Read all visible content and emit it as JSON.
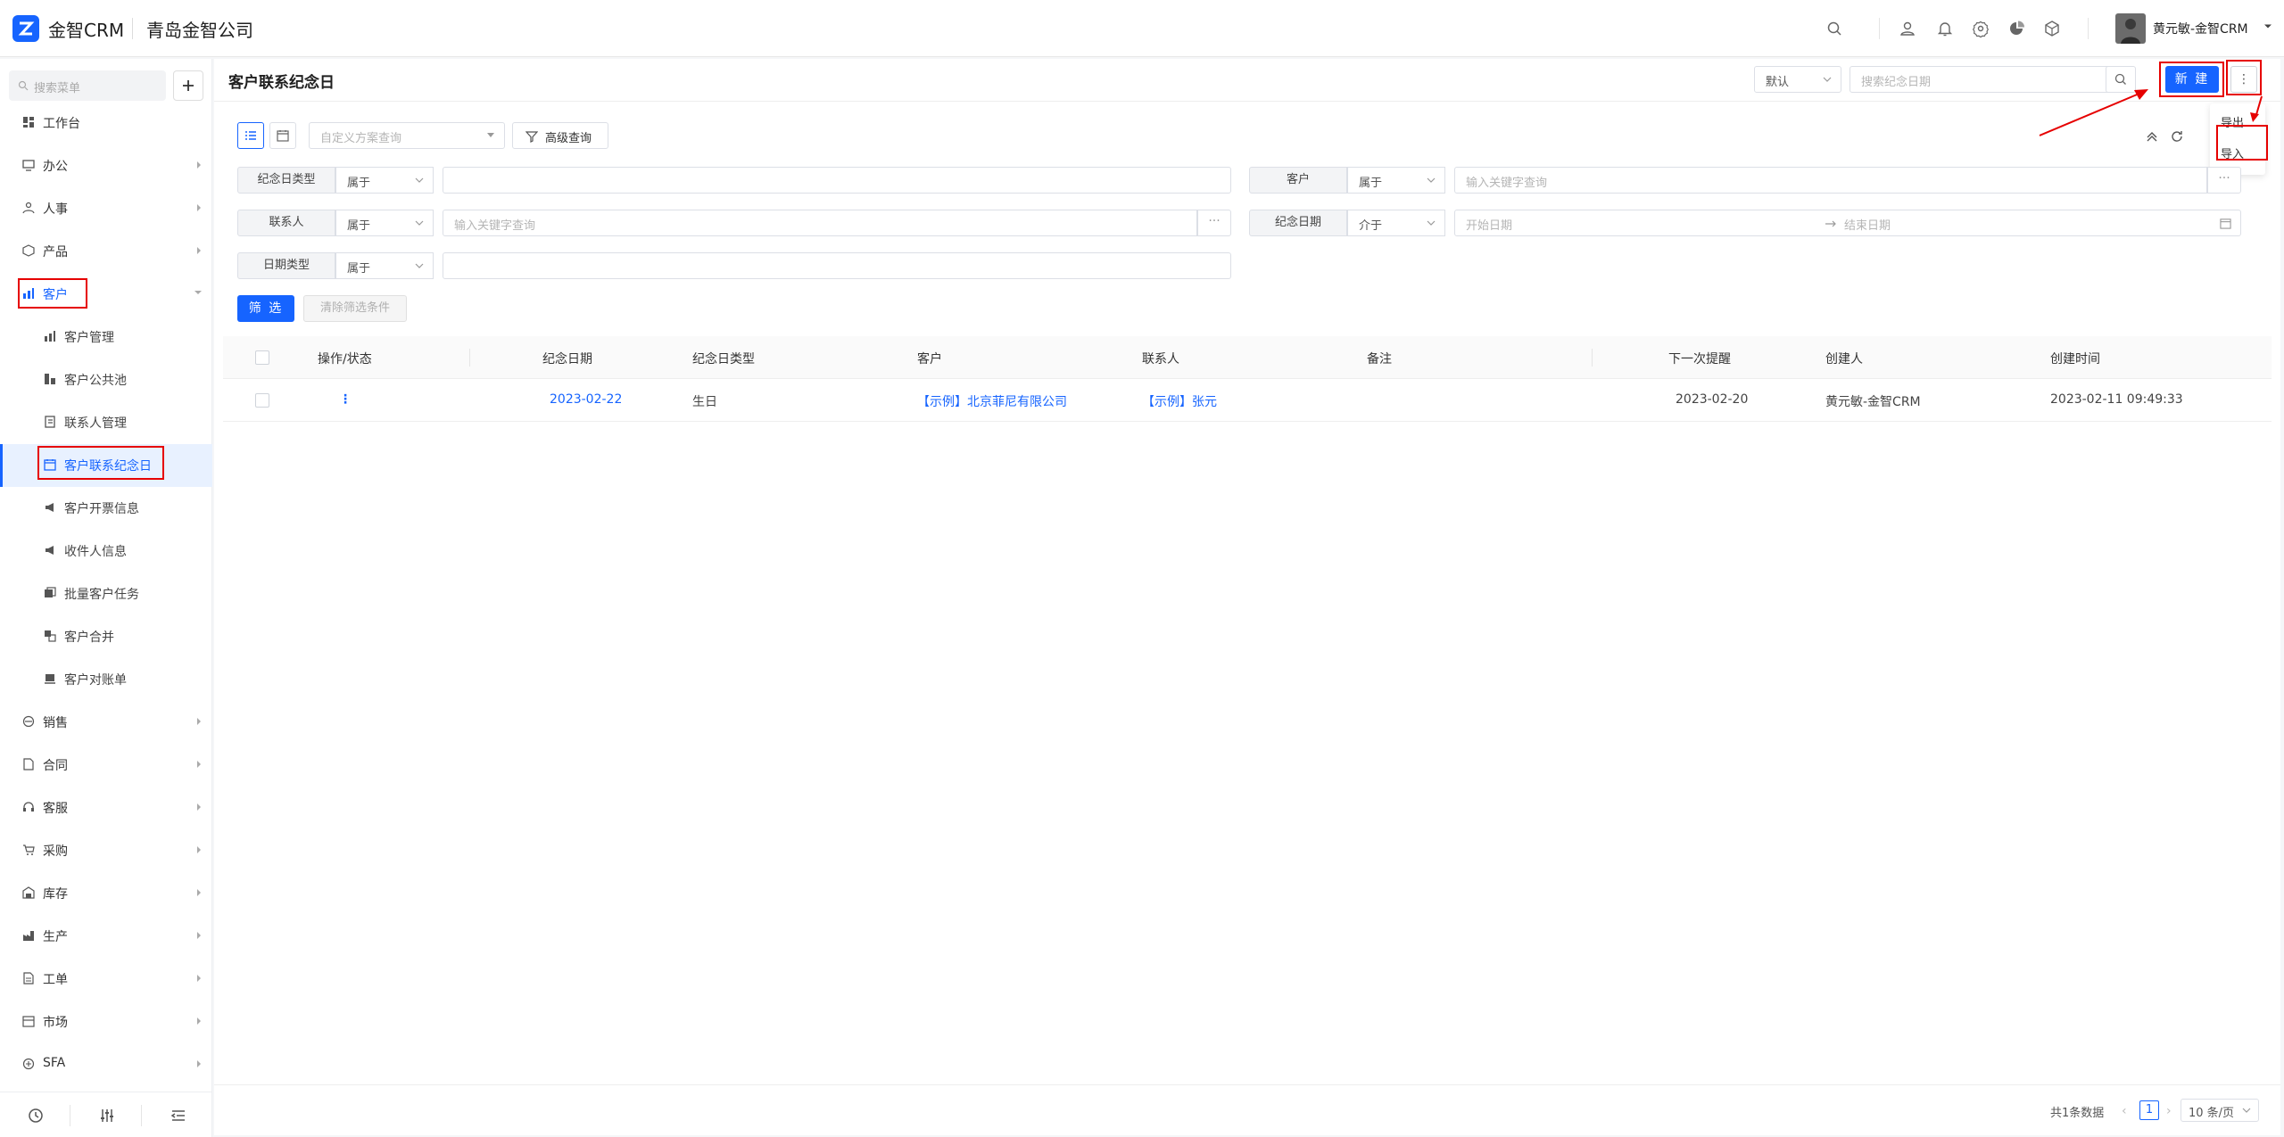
{
  "app": {
    "brand": "金智CRM",
    "company": "青岛金智公司",
    "user": "黄元敏-金智CRM"
  },
  "colors": {
    "accent": "#1664ff",
    "highlight_box": "#e60000"
  },
  "topbar_icons": [
    "search-icon",
    "contacts-icon",
    "bell-icon",
    "gear-icon",
    "pie-chart-icon",
    "cube-icon"
  ],
  "sidebar": {
    "search_placeholder": "搜索菜单",
    "items": [
      {
        "label": "工作台",
        "icon": "dashboard-icon"
      },
      {
        "label": "办公",
        "icon": "monitor-icon"
      },
      {
        "label": "人事",
        "icon": "people-icon"
      },
      {
        "label": "产品",
        "icon": "box-icon"
      },
      {
        "label": "客户",
        "icon": "chart-icon"
      },
      {
        "label": "销售",
        "icon": "target-icon"
      },
      {
        "label": "合同",
        "icon": "contract-icon"
      },
      {
        "label": "客服",
        "icon": "headset-icon"
      },
      {
        "label": "采购",
        "icon": "cart-icon"
      },
      {
        "label": "库存",
        "icon": "warehouse-icon"
      },
      {
        "label": "生产",
        "icon": "factory-icon"
      },
      {
        "label": "工单",
        "icon": "ticket-icon"
      },
      {
        "label": "市场",
        "icon": "store-icon"
      },
      {
        "label": "SFA",
        "icon": "sfa-icon"
      }
    ],
    "customer_sub": [
      {
        "label": "客户管理"
      },
      {
        "label": "客户公共池"
      },
      {
        "label": "联系人管理"
      },
      {
        "label": "客户联系纪念日"
      },
      {
        "label": "客户开票信息"
      },
      {
        "label": "收件人信息"
      },
      {
        "label": "批量客户任务"
      },
      {
        "label": "客户合并"
      },
      {
        "label": "客户对账单"
      }
    ]
  },
  "page": {
    "title": "客户联系纪念日",
    "view_select": "默认",
    "search_placeholder": "搜索纪念日期",
    "new_button": "新 建",
    "more_button": "⋮",
    "menu": {
      "export": "导出",
      "import": "导入"
    }
  },
  "filters": {
    "custom_query_placeholder": "自定义方案查询",
    "advanced": "高级查询",
    "rows": [
      {
        "label": "纪念日类型",
        "op": "属于",
        "placeholder": ""
      },
      {
        "label": "客户",
        "op": "属于",
        "placeholder": "输入关键字查询"
      },
      {
        "label": "联系人",
        "op": "属于",
        "placeholder": "输入关键字查询"
      },
      {
        "label": "纪念日期",
        "op": "介于",
        "start": "开始日期",
        "end": "结束日期"
      },
      {
        "label": "日期类型",
        "op": "属于",
        "placeholder": ""
      }
    ],
    "filter_button": "筛 选",
    "clear_button": "清除筛选条件"
  },
  "table": {
    "columns": [
      "操作/状态",
      "纪念日期",
      "纪念日类型",
      "客户",
      "联系人",
      "备注",
      "下一次提醒",
      "创建人",
      "创建时间"
    ],
    "rows": [
      {
        "action": "⋮",
        "date": "2023-02-22",
        "type": "生日",
        "customer": "【示例】北京菲尼有限公司",
        "contact": "【示例】张元",
        "note": "",
        "next_reminder": "2023-02-20",
        "creator": "黄元敏-金智CRM",
        "created_at": "2023-02-11 09:49:33"
      }
    ]
  },
  "pagination": {
    "total": "共1条数据",
    "current": "1",
    "page_size": "10 条/页"
  }
}
